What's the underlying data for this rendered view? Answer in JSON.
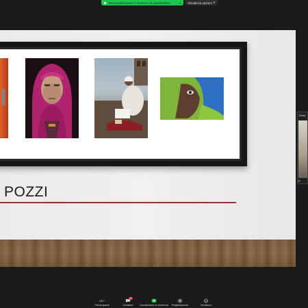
{
  "banner": {
    "sharing_text": "Stai visualizzando lo schermo di qualcheduno",
    "view_options": "Visualizza opzioni"
  },
  "slide": {
    "title": "POZZI",
    "accent_color": "#a8283b"
  },
  "participant": {
    "label_top": "Rima",
    "name": "P"
  },
  "toolbar": {
    "participants_label": "Partecipanti",
    "participants_count": "103",
    "chat_label": "Chattare",
    "chat_badge": "20",
    "share_label": "Condividere lo schermo",
    "record_label": "Registrazione",
    "reactions_label": "Reazioni"
  },
  "icons": [
    "participants-icon",
    "chat-icon",
    "share-screen-icon",
    "record-icon",
    "reactions-icon"
  ],
  "colors": {
    "share_green": "#23c552",
    "background": "#1a1a1a"
  }
}
